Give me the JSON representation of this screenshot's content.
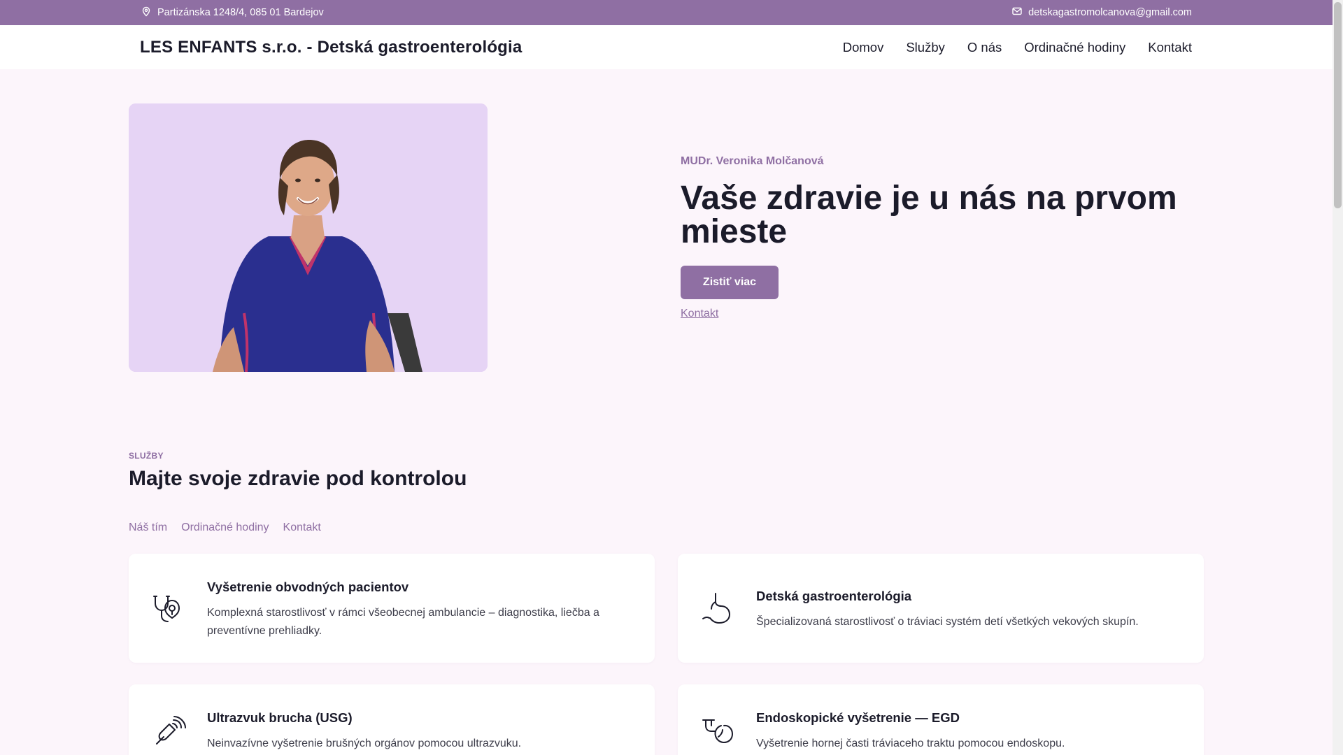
{
  "topbar": {
    "address": "Partizánska 1248/4, 085 01 Bardejov",
    "email": "detskagastromolcanova@gmail.com",
    "address_icon": "map-pin-icon",
    "email_icon": "mail-icon"
  },
  "header": {
    "brand": "LES ENFANTS s.r.o. - Detská gastroenterológia",
    "nav": [
      "Domov",
      "Služby",
      "O nás",
      "Ordinačné hodiny",
      "Kontakt"
    ]
  },
  "hero": {
    "eyebrow": "MUDr. Veronika Molčanová",
    "title": "Vaše zdravie je u nás na prvom mieste",
    "cta_label": "Zistiť viac",
    "link_label": "Kontakt"
  },
  "services": {
    "eyebrow": "SLUŽBY",
    "title": "Majte svoje zdravie pod kontrolou",
    "subnav": [
      "Náš tím",
      "Ordinačné hodiny",
      "Kontakt"
    ],
    "cards": [
      {
        "icon": "stethoscope-icon",
        "title": "Vyšetrenie obvodných pacientov",
        "desc": "Komplexná starostlivosť v rámci všeobecnej ambulancie – diagnostika, liečba a preventívne prehliadky."
      },
      {
        "icon": "stomach-icon",
        "title": "Detská gastroenterológia",
        "desc": "Špecializovaná starostlivosť o tráviaci systém detí všetkých vekových skupín."
      },
      {
        "icon": "ultrasound-probe-icon",
        "title": "Ultrazvuk brucha (USG)",
        "desc": "Neinvazívne vyšetrenie brušných orgánov pomocou ultrazvuku."
      },
      {
        "icon": "endoscope-icon",
        "title": "Endoskopické vyšetrenie — EGD",
        "desc": "Vyšetrenie hornej časti tráviaceho traktu pomocou endoskopu."
      }
    ]
  },
  "colors": {
    "accent": "#8f6fa3",
    "page_bg": "#fcf5fb",
    "photo_bg": "#e6d4f5",
    "scrub_blue": "#2a2f8f"
  }
}
